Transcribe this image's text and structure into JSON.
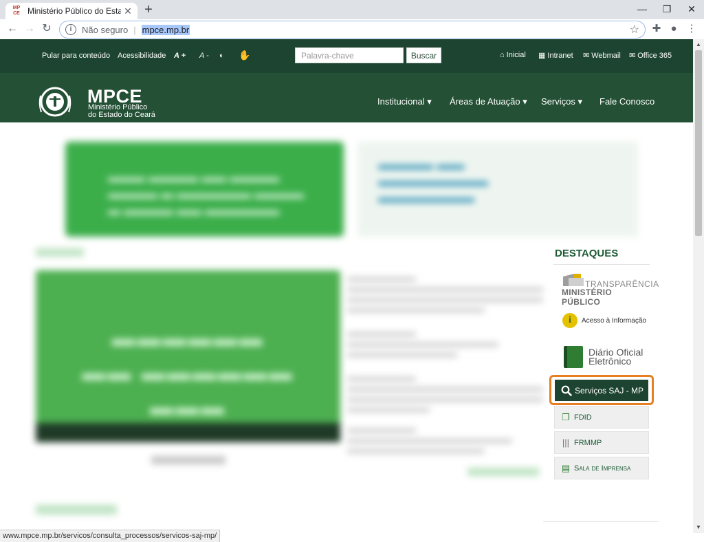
{
  "browser": {
    "tab_title": "Ministério Público do Estado do",
    "tab_favicon": "MP CE",
    "insecure_label": "Não seguro",
    "url": "mpce.mp.br",
    "status_url": "www.mpce.mp.br/servicos/consulta_processos/servicos-saj-mp/"
  },
  "topbar": {
    "skip_link": "Pular para conteúdo",
    "accessibility": "Acessibilidade",
    "font_increase": "A +",
    "font_decrease": "A -",
    "search_placeholder": "Palavra-chave",
    "search_button": "Buscar",
    "links": [
      "Inicial",
      "Intranet",
      "Webmail",
      "Office 365"
    ]
  },
  "header": {
    "logo_title": "MPCE",
    "logo_sub1": "Ministério Público",
    "logo_sub2": "do Estado do Ceará",
    "nav": [
      "Institucional",
      "Áreas de Atuação",
      "Serviços",
      "Fale Conosco"
    ]
  },
  "sidebar": {
    "title": "DESTAQUES",
    "transparencia_1": "TRANSPARÊNCIA",
    "transparencia_2": "MINISTÉRIO PÚBLICO",
    "acesso": "Acesso à Informação",
    "diario_1": "Diário Oficial",
    "diario_2": "Eletrônico",
    "saj": "Serviços SAJ - MP",
    "fdid": "FDID",
    "frmmp": "FRMMP",
    "sala_imprensa": "Sala de Imprensa"
  },
  "colors": {
    "topbar": "#1d4430",
    "header": "#245035",
    "highlight": "#e67e22"
  }
}
